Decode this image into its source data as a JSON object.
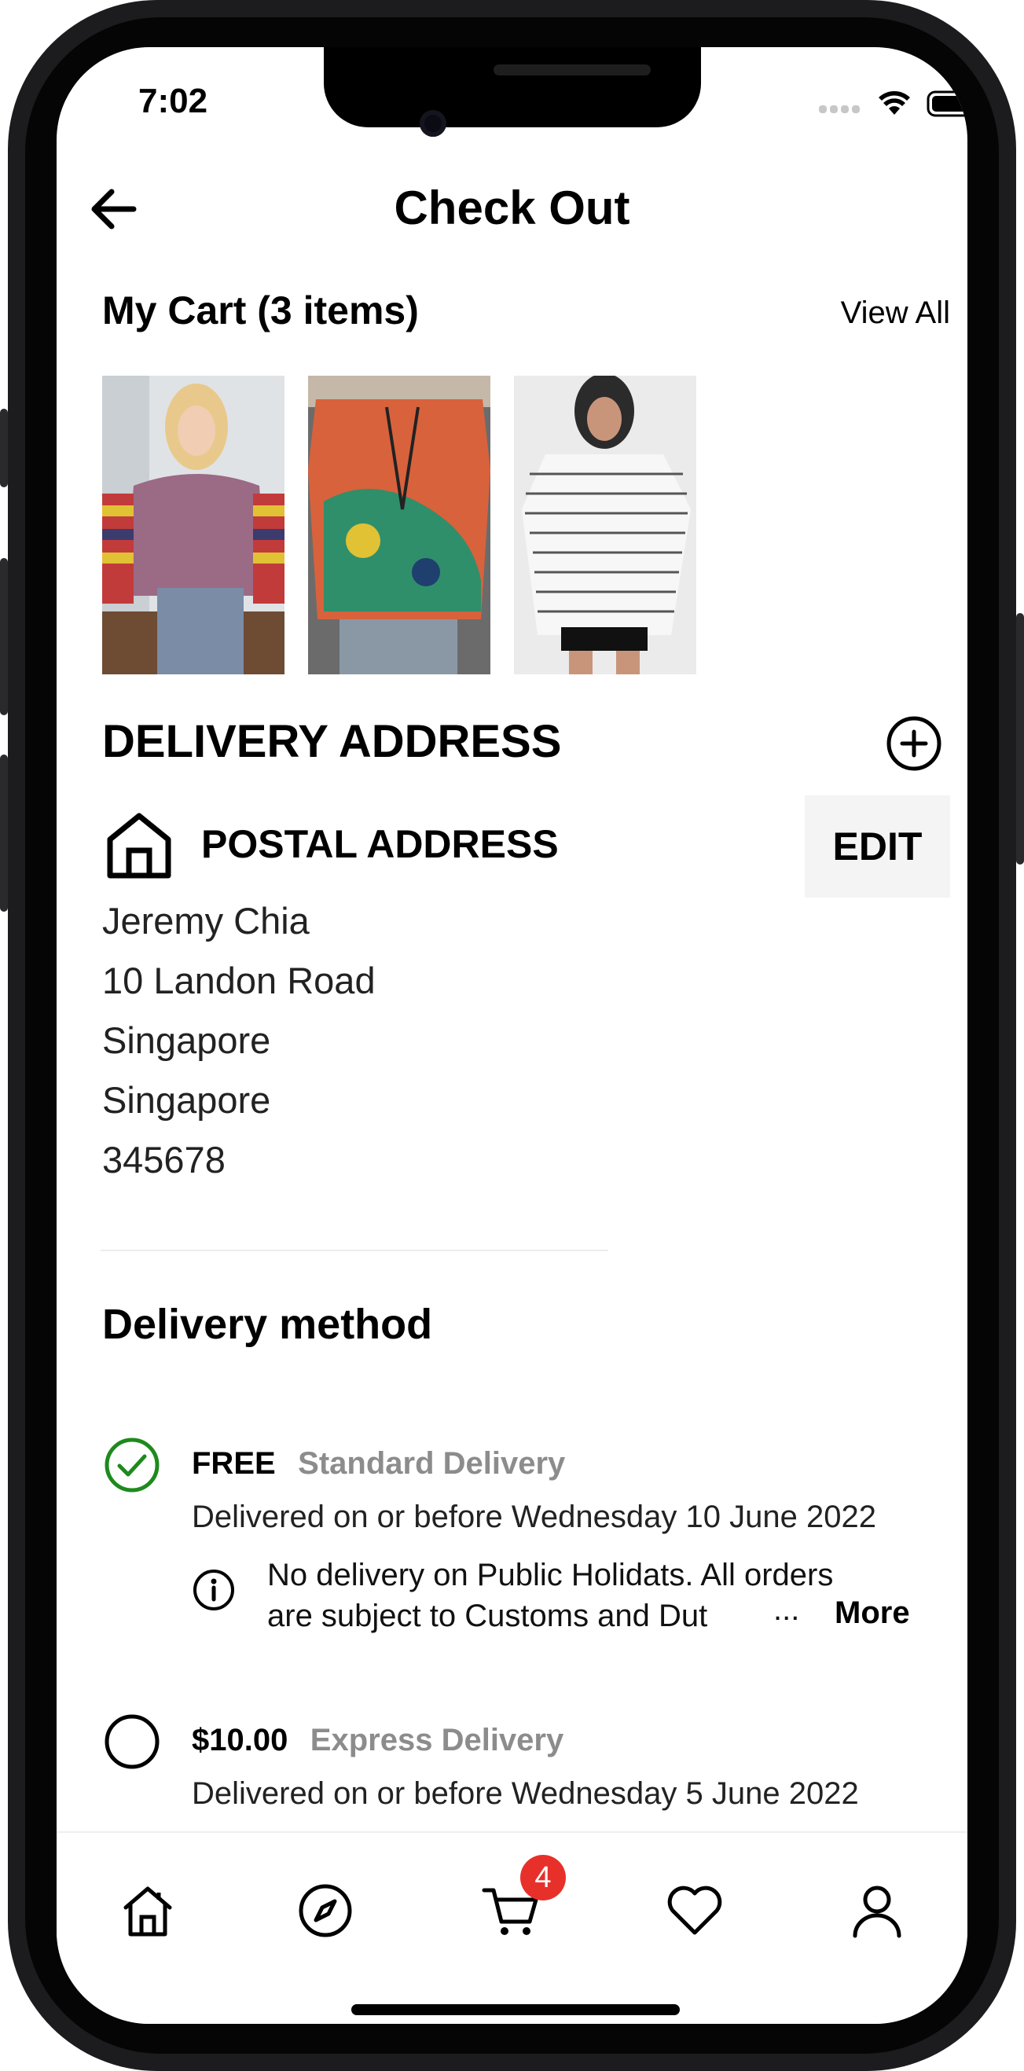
{
  "status_bar": {
    "time": "7:02"
  },
  "header": {
    "title": "Check Out"
  },
  "cart": {
    "heading": "My Cart (3 items)",
    "view_all": "View All",
    "items": [
      {
        "name": "Women's purple sweater with striped sleeves"
      },
      {
        "name": "Colorful abstract print oversized shirt"
      },
      {
        "name": "White striped oversized v-neck tee"
      }
    ]
  },
  "delivery_address": {
    "heading": "DELIVERY ADDRESS",
    "type_label": "POSTAL ADDRESS",
    "edit_label": "EDIT",
    "lines": [
      "Jeremy Chia",
      "10 Landon Road",
      "Singapore",
      "Singapore",
      "345678"
    ]
  },
  "delivery_method": {
    "heading": "Delivery method",
    "options": [
      {
        "price": "FREE",
        "name": "Standard Delivery",
        "description": "Delivered on or before Wednesday 10 June 2022",
        "selected": true
      },
      {
        "price": "$10.00",
        "name": "Express Delivery",
        "description": "Delivered on or before Wednesday 5 June 2022",
        "selected": false
      }
    ],
    "notice": {
      "line1": "No delivery on Public Holidats. All orders",
      "line2": "are subject to Customs and Dut",
      "ellipsis": "...",
      "more": "More"
    }
  },
  "tab_bar": {
    "tabs": [
      {
        "icon": "home-icon"
      },
      {
        "icon": "compass-icon"
      },
      {
        "icon": "cart-icon",
        "badge": "4"
      },
      {
        "icon": "heart-icon"
      },
      {
        "icon": "user-icon"
      }
    ]
  },
  "colors": {
    "selected": "#1e8a1e",
    "badge": "#e8302a",
    "muted": "#8c8c8c"
  }
}
